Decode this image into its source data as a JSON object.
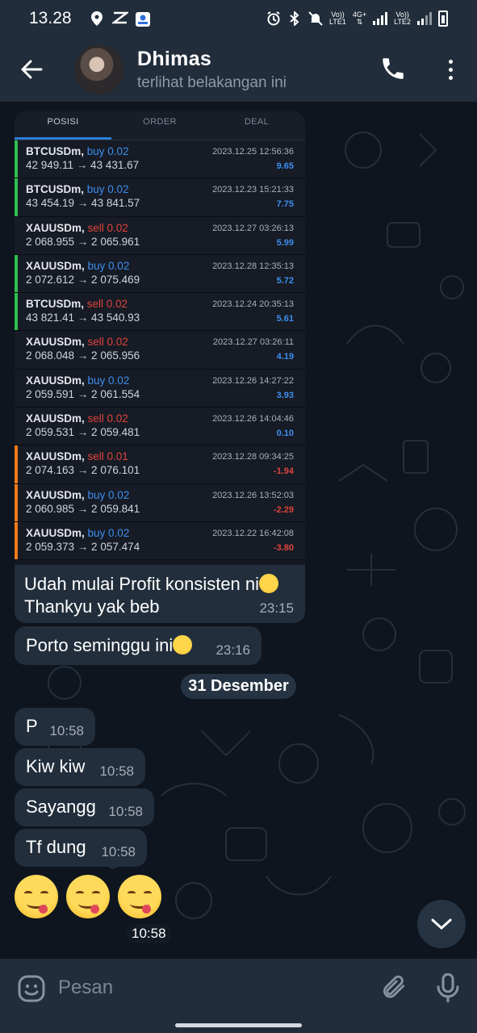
{
  "status_bar": {
    "time": "13.28",
    "net1_top": "Vo))",
    "net1_bottom": "LTE1",
    "net_4g": "4G+",
    "net2_top": "Vo))",
    "net2_bottom": "LTE2"
  },
  "header": {
    "contact_name": "Dhimas",
    "contact_status": "terlihat belakangan ini"
  },
  "screenshot": {
    "tabs": [
      "POSISI",
      "ORDER",
      "DEAL"
    ],
    "trades": [
      {
        "symbol": "BTCUSDm,",
        "side": "buy 0.02",
        "type": "buy",
        "prices": "42 949.11 → 43 431.67",
        "date": "2023.12.25 12:56:36",
        "pnl": "9.65",
        "bar": "#2fbf4f"
      },
      {
        "symbol": "BTCUSDm,",
        "side": "buy 0.02",
        "type": "buy",
        "prices": "43 454.19 → 43 841.57",
        "date": "2023.12.23 15:21:33",
        "pnl": "7.75",
        "bar": "#2fbf4f"
      },
      {
        "symbol": "XAUUSDm,",
        "side": "sell 0.02",
        "type": "sell",
        "prices": "2 068.955 → 2 065.961",
        "date": "2023.12.27 03:26:13",
        "pnl": "5.99",
        "bar": ""
      },
      {
        "symbol": "XAUUSDm,",
        "side": "buy 0.02",
        "type": "buy",
        "prices": "2 072.612 → 2 075.469",
        "date": "2023.12.28 12:35:13",
        "pnl": "5.72",
        "bar": "#2fbf4f"
      },
      {
        "symbol": "BTCUSDm,",
        "side": "sell 0.02",
        "type": "sell",
        "prices": "43 821.41 → 43 540.93",
        "date": "2023.12.24 20:35:13",
        "pnl": "5.61",
        "bar": "#2fbf4f"
      },
      {
        "symbol": "XAUUSDm,",
        "side": "sell 0.02",
        "type": "sell",
        "prices": "2 068.048 → 2 065.956",
        "date": "2023.12.27 03:26:11",
        "pnl": "4.19",
        "bar": ""
      },
      {
        "symbol": "XAUUSDm,",
        "side": "buy 0.02",
        "type": "buy",
        "prices": "2 059.591 → 2 061.554",
        "date": "2023.12.26 14:27:22",
        "pnl": "3.93",
        "bar": ""
      },
      {
        "symbol": "XAUUSDm,",
        "side": "sell 0.02",
        "type": "sell",
        "prices": "2 059.531 → 2 059.481",
        "date": "2023.12.26 14:04:46",
        "pnl": "0.10",
        "bar": ""
      },
      {
        "symbol": "XAUUSDm,",
        "side": "sell 0.01",
        "type": "sell",
        "prices": "2 074.163 → 2 076.101",
        "date": "2023.12.28 09:34:25",
        "pnl": "-1.94",
        "bar": "#f07a1a"
      },
      {
        "symbol": "XAUUSDm,",
        "side": "buy 0.02",
        "type": "buy",
        "prices": "2 060.985 → 2 059.841",
        "date": "2023.12.26 13:52:03",
        "pnl": "-2.29",
        "bar": "#f07a1a"
      },
      {
        "symbol": "XAUUSDm,",
        "side": "buy 0.02",
        "type": "buy",
        "prices": "2 059.373 → 2 057.474",
        "date": "2023.12.22 16:42:08",
        "pnl": "-3.80",
        "bar": "#f07a1a"
      }
    ],
    "colors": {
      "profit": "#3d8ff0",
      "loss": "#e0443c"
    }
  },
  "messages": {
    "m1_line1": "Udah mulai Profit konsisten ni",
    "m1_line2": "Thankyu yak beb",
    "m1_time": "23:15",
    "m2_text": "Porto seminggu ini",
    "m2_time": "23:16",
    "date_divider": "31 Desember",
    "m3_text": "P",
    "m3_time": "10:58",
    "m4_text": "Kiw kiw",
    "m4_time": "10:58",
    "m5_text": "Sayangg",
    "m5_time": "10:58",
    "m6_text": "Tf dung",
    "m6_time": "10:58",
    "emoji_time": "10:58"
  },
  "input": {
    "placeholder": "Pesan"
  }
}
